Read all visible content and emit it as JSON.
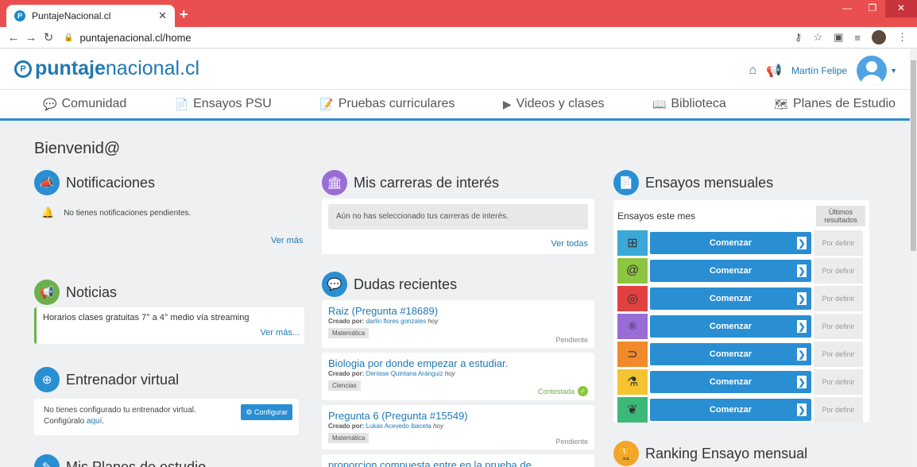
{
  "browser": {
    "tab_title": "PuntajeNacional.cl",
    "url": "puntajenacional.cl/home"
  },
  "site": {
    "logo_bold": "puntaje",
    "logo_rest": "nacional.cl",
    "user_name": "Martín Felipe"
  },
  "nav": [
    {
      "label": "Comunidad",
      "icon": "chat-icon"
    },
    {
      "label": "Ensayos PSU",
      "icon": "document-icon"
    },
    {
      "label": "Pruebas curriculares",
      "icon": "test-icon"
    },
    {
      "label": "Videos y clases",
      "icon": "play-icon"
    },
    {
      "label": "Biblioteca",
      "icon": "book-icon"
    },
    {
      "label": "Planes de Estudio",
      "icon": "plan-icon"
    }
  ],
  "welcome": "Bienvenid@",
  "notifications": {
    "title": "Notificaciones",
    "empty": "No tienes notificaciones pendientes.",
    "more": "Ver más"
  },
  "news": {
    "title": "Noticias",
    "item": "Horarios clases gratuitas 7° a 4° medio vía streaming",
    "more": "Ver más..."
  },
  "trainer": {
    "title": "Entrenador virtual",
    "text1": "No tienes configurado tu entrenador virtual.",
    "text2_prefix": "Configúralo ",
    "text2_link": "aquí",
    "text2_suffix": ".",
    "button": "Configurar"
  },
  "plans": {
    "title": "Mis Planes de estudio"
  },
  "careers": {
    "title": "Mis carreras de interés",
    "empty": "Aún no has seleccionado tus carreras de interés.",
    "more": "Ver todas"
  },
  "doubts": {
    "title": "Dudas recientes",
    "items": [
      {
        "title": "Raiz (Pregunta #18689)",
        "created_label": "Creado por:",
        "author": "darlin flores gonzales",
        "time": "hoy",
        "tag": "Matemática",
        "status": "Pendiente"
      },
      {
        "title": "Biologia por donde empezar a estudiar.",
        "created_label": "Creado por:",
        "author": "Denisse Quintana Aránguiz",
        "time": "hoy",
        "tag": "Ciencias",
        "status": "Contestada"
      },
      {
        "title": "Pregunta 6 (Pregunta #15549)",
        "created_label": "Creado por:",
        "author": "Lukas Acevedo ibaceta",
        "time": "hoy",
        "tag": "Matemática",
        "status": "Pendiente"
      },
      {
        "title": "proporcion compuesta entre en la prueba de"
      }
    ]
  },
  "monthly": {
    "title": "Ensayos mensuales",
    "header": "Ensayos este mes",
    "results_header": "Últimos resultados",
    "rows": [
      {
        "icon": "calculator-icon",
        "color": "#3aa8d8",
        "button": "Comenzar",
        "result": "Por definir"
      },
      {
        "icon": "at-sign-icon",
        "color": "#8cc63f",
        "button": "Comenzar",
        "result": "Por definir"
      },
      {
        "icon": "globe-icon",
        "color": "#e04040",
        "button": "Comenzar",
        "result": "Por definir"
      },
      {
        "icon": "atom-icon",
        "color": "#9a6dd6",
        "button": "Comenzar",
        "result": "Por definir"
      },
      {
        "icon": "magnet-icon",
        "color": "#f08a2a",
        "button": "Comenzar",
        "result": "Por definir"
      },
      {
        "icon": "flask-icon",
        "color": "#f4c430",
        "button": "Comenzar",
        "result": "Por definir"
      },
      {
        "icon": "sprout-icon",
        "color": "#3cb878",
        "button": "Comenzar",
        "result": "Por definir"
      }
    ]
  },
  "ranking": {
    "title": "Ranking Ensayo mensual"
  }
}
